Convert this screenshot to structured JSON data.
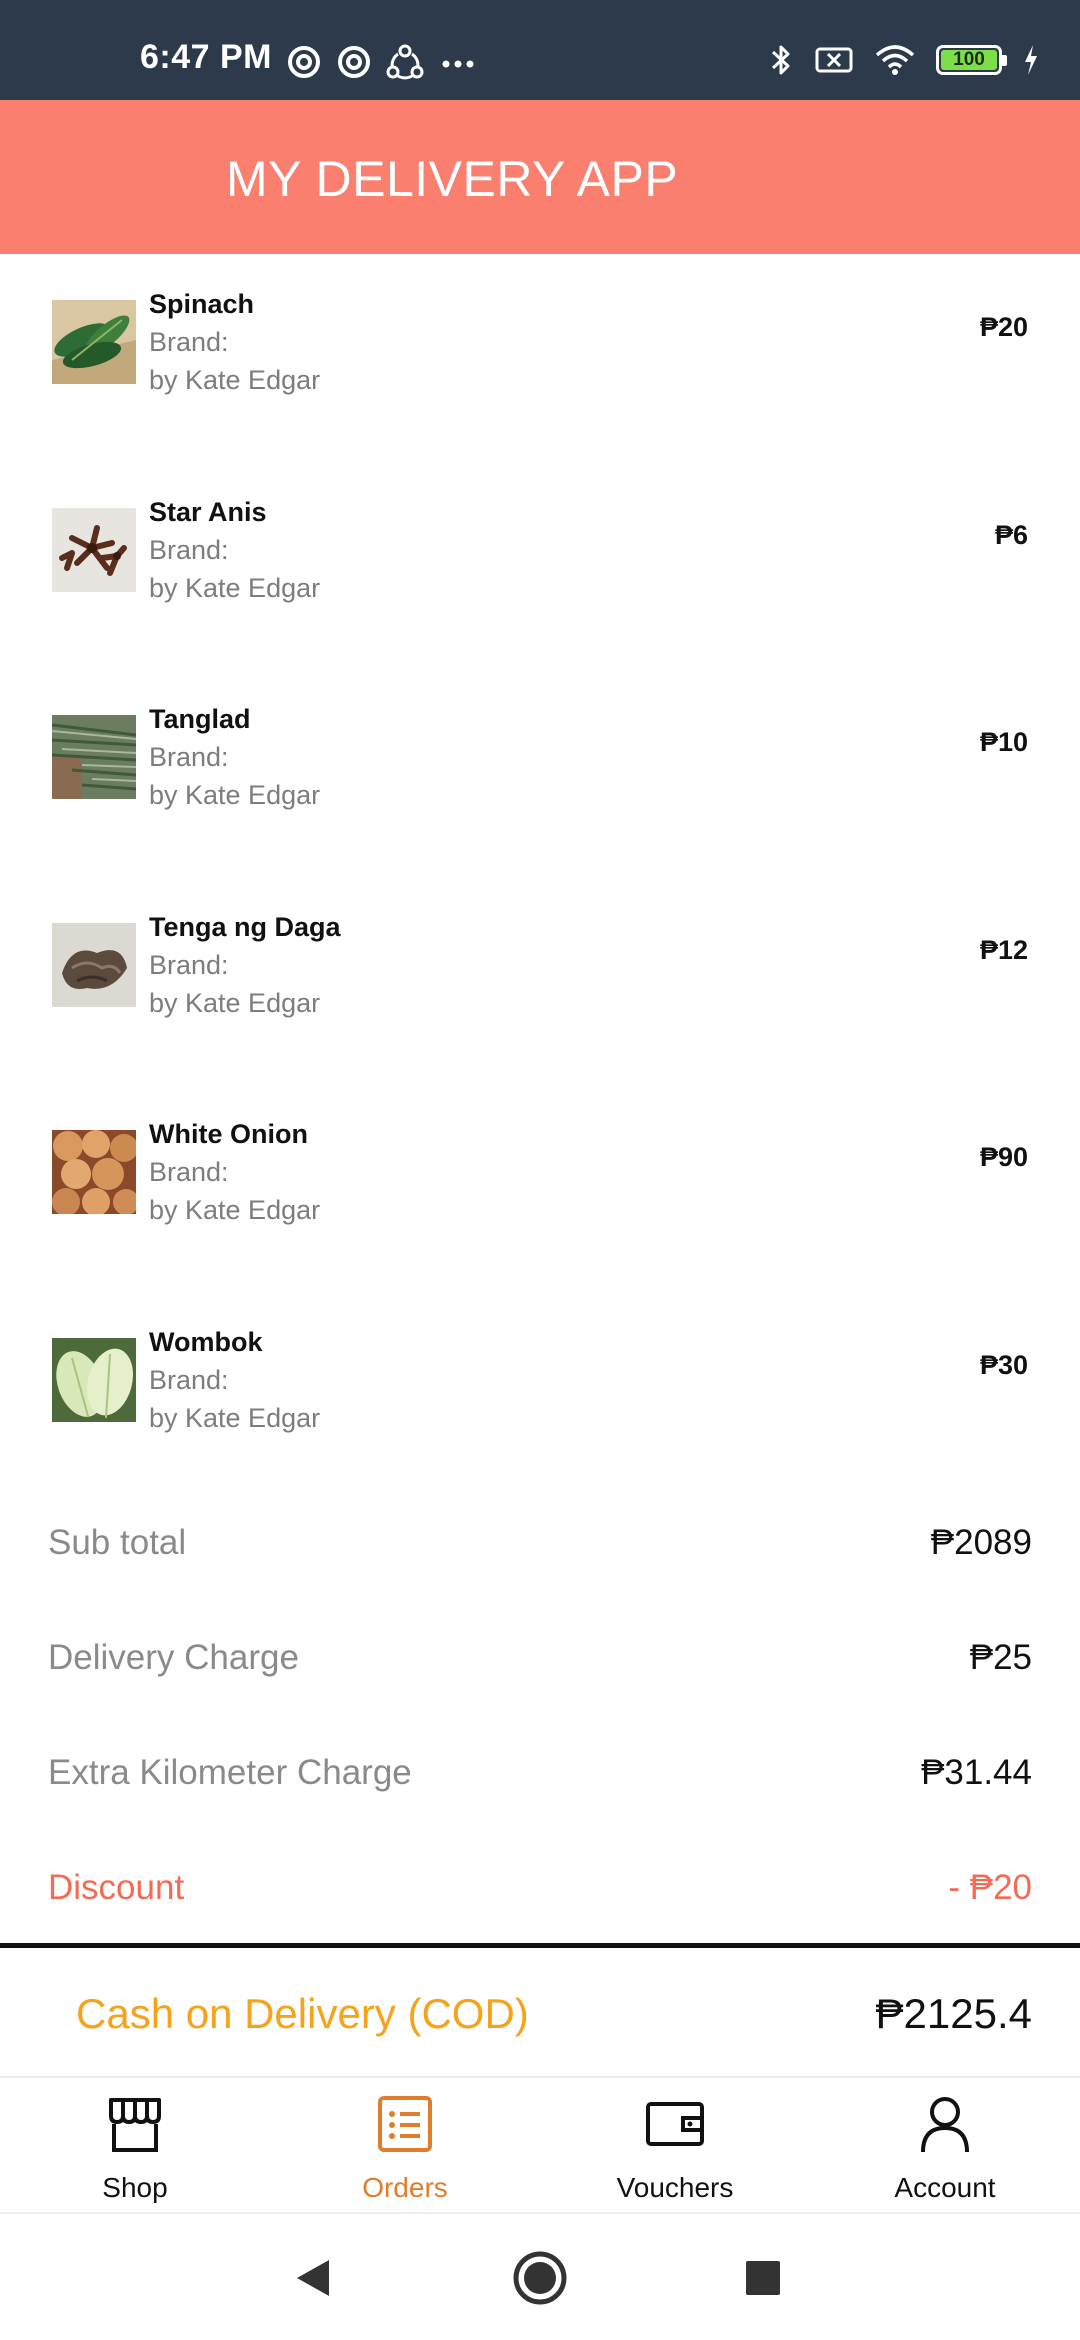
{
  "status_bar": {
    "time": "6:47 PM",
    "battery_level": "100"
  },
  "header": {
    "title": "MY DELIVERY APP"
  },
  "items": [
    {
      "name": "Spinach",
      "brand": "Brand:",
      "by": "by Kate Edgar",
      "price": "₱20"
    },
    {
      "name": "Star Anis",
      "brand": "Brand:",
      "by": "by Kate Edgar",
      "price": "₱6"
    },
    {
      "name": "Tanglad",
      "brand": "Brand:",
      "by": "by Kate Edgar",
      "price": "₱10"
    },
    {
      "name": "Tenga ng Daga",
      "brand": "Brand:",
      "by": "by Kate Edgar",
      "price": "₱12"
    },
    {
      "name": "White Onion",
      "brand": "Brand:",
      "by": "by Kate Edgar",
      "price": "₱90"
    },
    {
      "name": "Wombok",
      "brand": "Brand:",
      "by": "by Kate Edgar",
      "price": "₱30"
    }
  ],
  "summary": {
    "subtotal_label": "Sub total",
    "subtotal_value": "₱2089",
    "delivery_label": "Delivery Charge",
    "delivery_value": "₱25",
    "extra_km_label": "Extra Kilometer Charge",
    "extra_km_value": "₱31.44",
    "discount_label": "Discount",
    "discount_value": "- ₱20"
  },
  "payment": {
    "method_label": "Cash on Delivery (COD)",
    "total": "₱2125.4"
  },
  "bottom_nav": [
    {
      "label": "Shop",
      "icon": "shop-icon",
      "active": false
    },
    {
      "label": "Orders",
      "icon": "orders-icon",
      "active": true
    },
    {
      "label": "Vouchers",
      "icon": "wallet-icon",
      "active": false
    },
    {
      "label": "Account",
      "icon": "account-icon",
      "active": false
    }
  ],
  "colors": {
    "status_bar": "#2d3a4b",
    "header": "#fa7f6f",
    "cod": "#f6a21a",
    "discount": "#f26b54",
    "active_nav": "#e07d2c"
  }
}
